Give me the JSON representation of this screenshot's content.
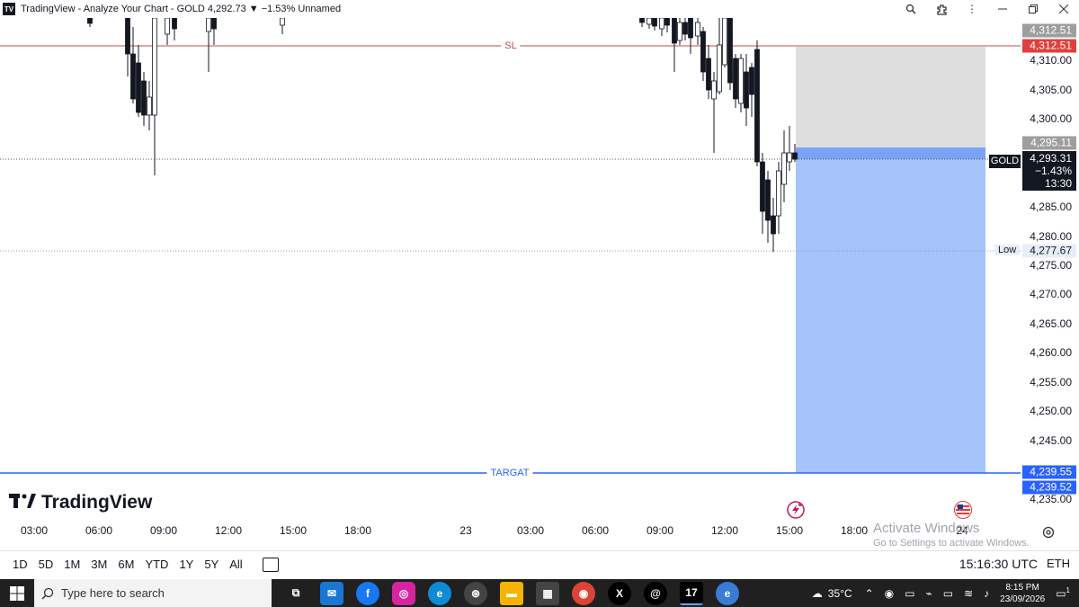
{
  "window": {
    "title": "TradingView - Analyze Your Chart - GOLD 4,292.73 ▼ −1.53% Unnamed",
    "buttons": [
      "zoom-icon",
      "extension-icon",
      "more-icon",
      "minimize",
      "maximize",
      "close"
    ]
  },
  "chart": {
    "symbol": "GOLD",
    "price_ticks": [
      "4,310.00",
      "4,305.00",
      "4,300.00",
      "4,285.00",
      "4,280.00",
      "4,275.00",
      "4,270.00",
      "4,265.00",
      "4,260.00",
      "4,255.00",
      "4,250.00",
      "4,245.00",
      "4,235.00"
    ],
    "sl_label": "SL",
    "target_label": "TARGAT",
    "sl_price_top": "4,312.51",
    "sl_price": "4,312.51",
    "entry_price": "4,295.11",
    "last_price": "4,293.31",
    "change_pct": "−1.43%",
    "countdown": "13:30",
    "low_label": "Low",
    "low_price": "4,277.67",
    "target_price_top": "4,239.55",
    "target_price": "4,239.52",
    "colors": {
      "up": "#ffffff",
      "down": "#131722",
      "sl": "#c74b4b",
      "target": "#2962ff",
      "tp_zone": "#a5c4fb",
      "sl_zone": "#dedede"
    }
  },
  "time_axis": [
    "03:00",
    "06:00",
    "09:00",
    "12:00",
    "15:00",
    "18:00",
    "23",
    "03:00",
    "06:00",
    "09:00",
    "12:00",
    "15:00",
    "18:00",
    "24"
  ],
  "branding": {
    "logo": "TradingView"
  },
  "watermark": {
    "line1": "Activate Windows",
    "line2": "Go to Settings to activate Windows."
  },
  "range_bar": {
    "ranges": [
      "1D",
      "5D",
      "1M",
      "3M",
      "6M",
      "YTD",
      "1Y",
      "5Y",
      "All"
    ],
    "clock": "15:16:30 UTC",
    "session": "ETH"
  },
  "taskbar": {
    "search_placeholder": "Type here to search",
    "weather": "35°C",
    "time": "8:15 PM",
    "date": "23/09/2026",
    "notification_count": "1",
    "apps": [
      "task-view",
      "mail",
      "facebook",
      "instagram",
      "edge",
      "chatgpt",
      "file-explorer",
      "store",
      "chrome",
      "x",
      "threads",
      "tradingview",
      "edge-beta"
    ]
  }
}
